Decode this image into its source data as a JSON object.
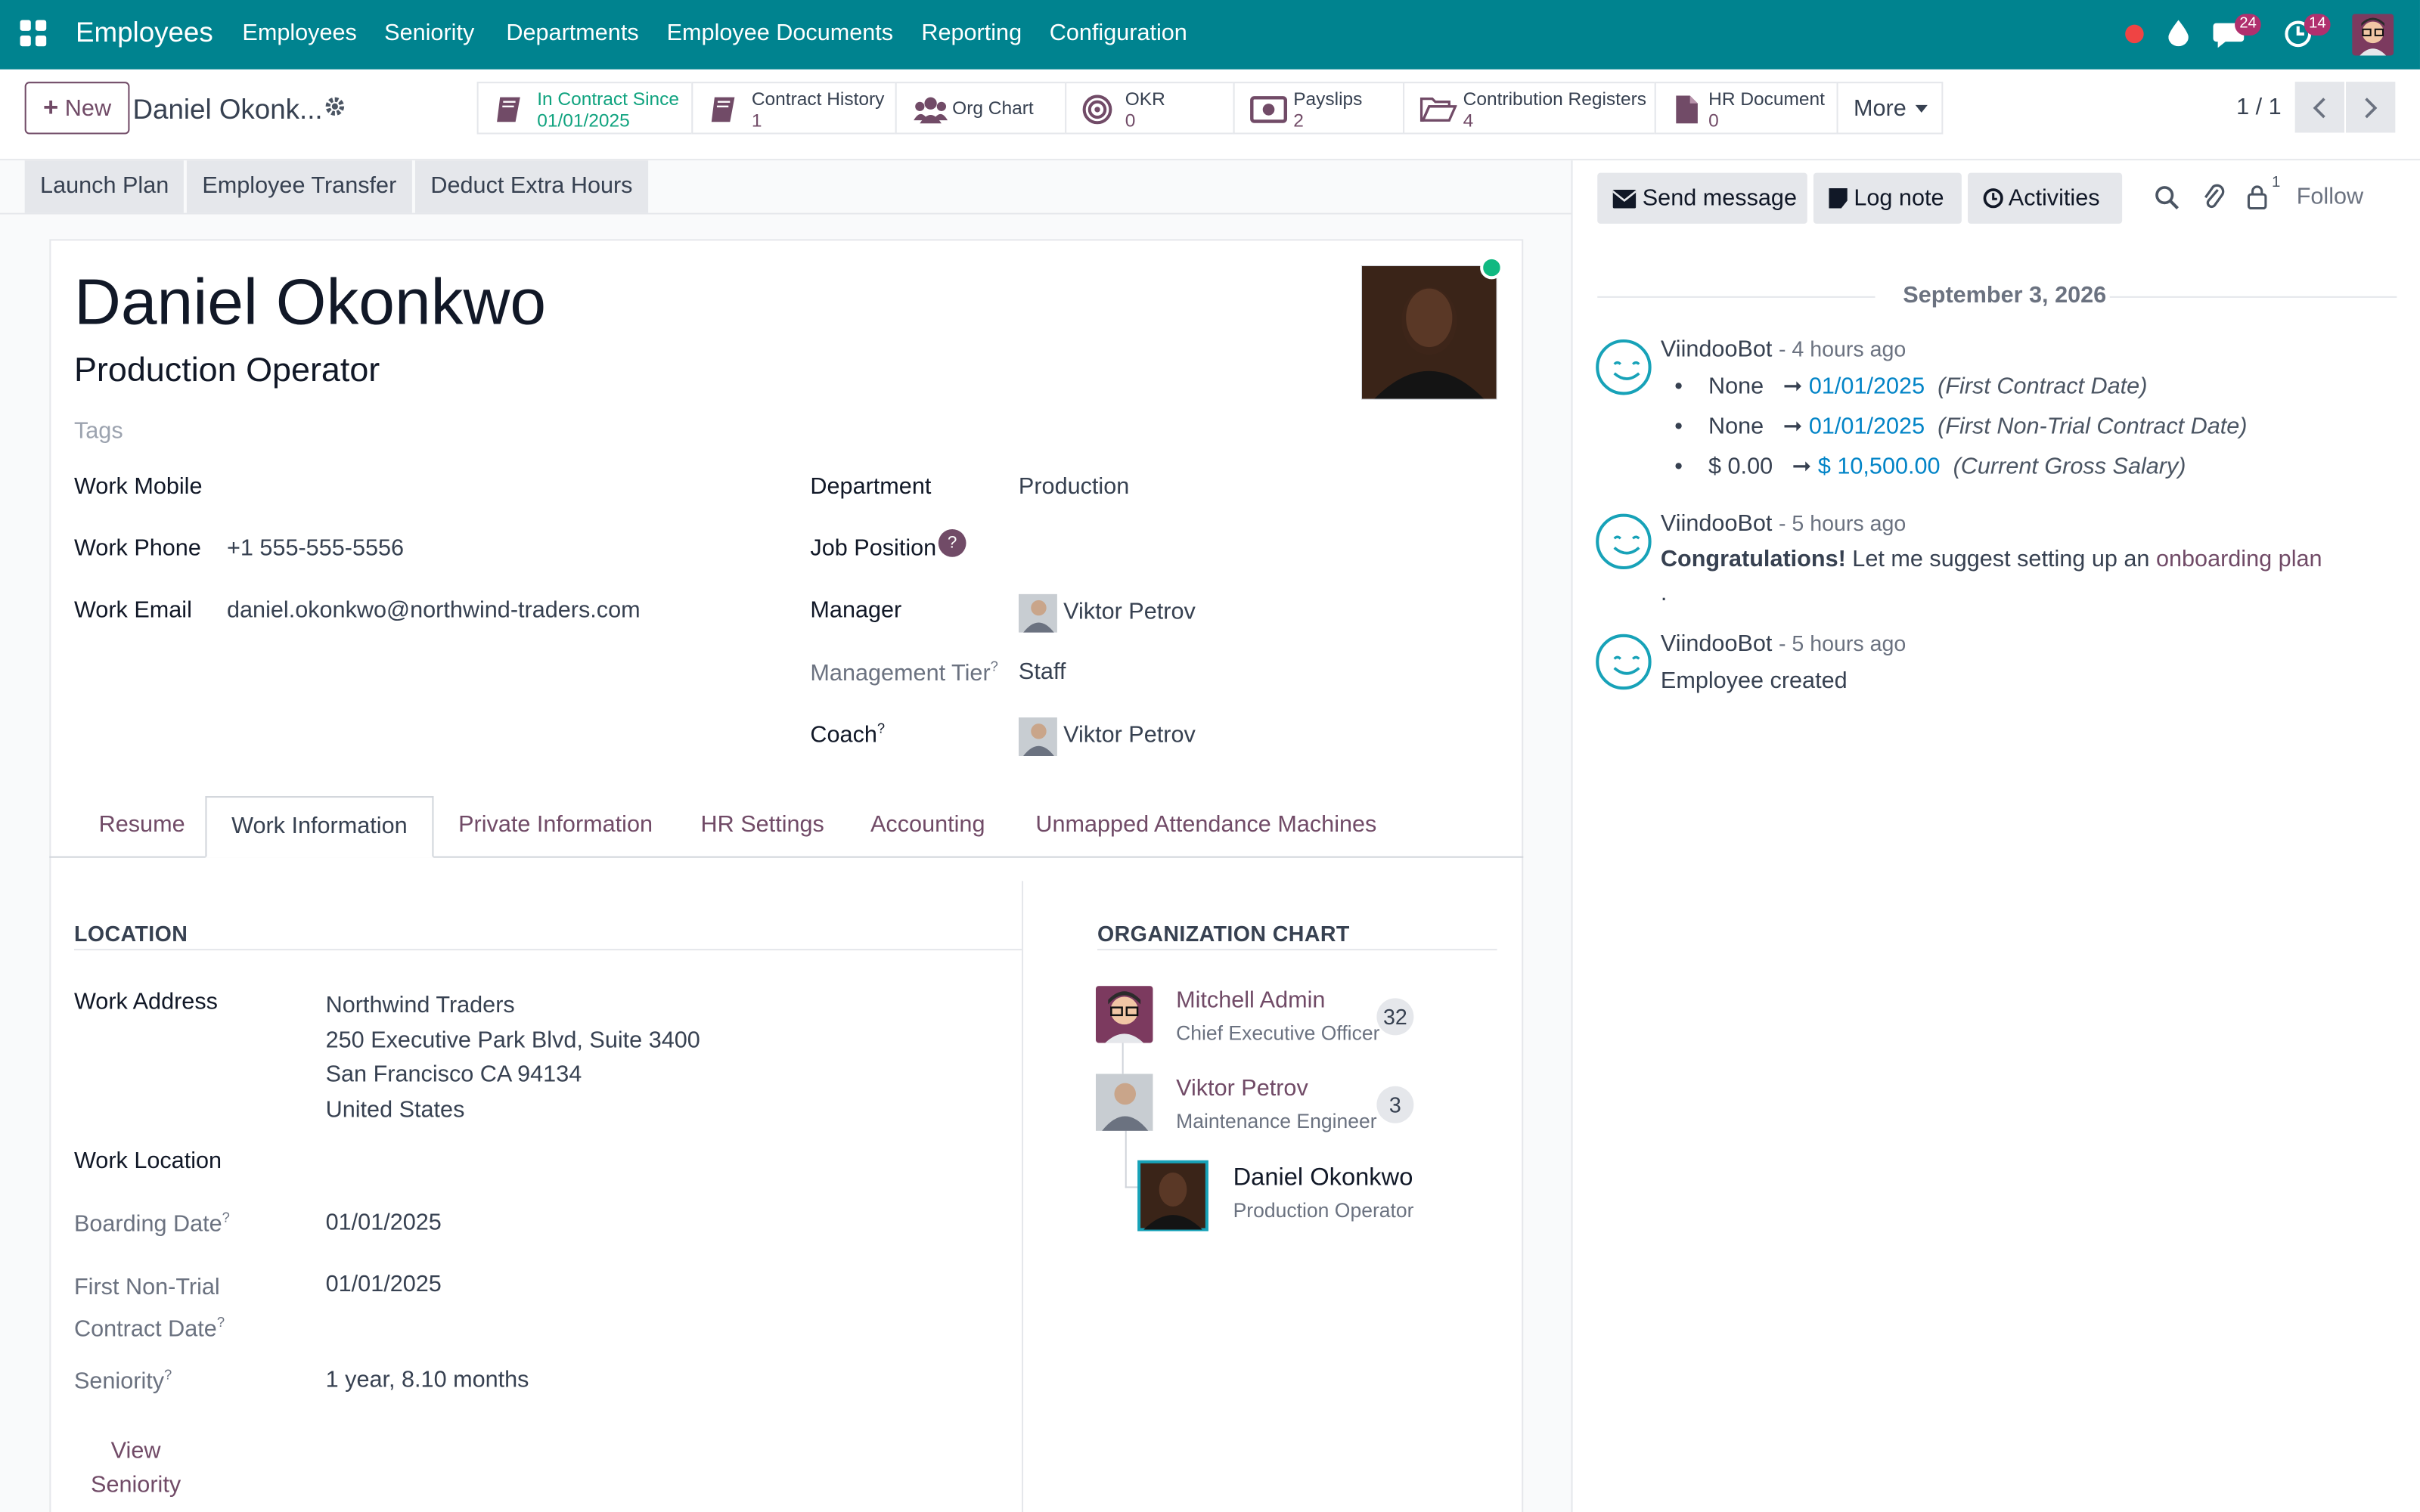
{
  "nav": {
    "app": "Employees",
    "menus": [
      "Employees",
      "Seniority",
      "Departments",
      "Employee Documents",
      "Reporting",
      "Configuration"
    ],
    "chat_count": "24",
    "activity_count": "14"
  },
  "control": {
    "new_label": "New",
    "record_name": "Daniel Okonk...",
    "pager": "1 / 1"
  },
  "smart_buttons": [
    {
      "label": "In Contract Since",
      "value": "01/01/2025"
    },
    {
      "label": "Contract History",
      "value": "1"
    },
    {
      "label": "Org Chart",
      "value": ""
    },
    {
      "label": "OKR",
      "value": "0"
    },
    {
      "label": "Payslips",
      "value": "2"
    },
    {
      "label": "Contribution Registers",
      "value": "4"
    },
    {
      "label": "HR Document",
      "value": "0"
    },
    {
      "label": "More",
      "value": ""
    }
  ],
  "actions": [
    "Launch Plan",
    "Employee Transfer",
    "Deduct Extra Hours"
  ],
  "employee": {
    "name": "Daniel Okonkwo",
    "job_title": "Production Operator",
    "tags_placeholder": "Tags"
  },
  "fields_left": [
    {
      "label": "Work Mobile",
      "value": ""
    },
    {
      "label": "Work Phone",
      "value": "+1 555-555-5556"
    },
    {
      "label": "Work Email",
      "value": "daniel.okonkwo@northwind-traders.com"
    }
  ],
  "fields_right": {
    "department": {
      "label": "Department",
      "value": "Production"
    },
    "job_position": {
      "label": "Job Position",
      "help": "?"
    },
    "manager": {
      "label": "Manager",
      "value": "Viktor Petrov"
    },
    "management_tier": {
      "label": "Management Tier",
      "help": "?",
      "value": "Staff"
    },
    "coach": {
      "label": "Coach",
      "help": "?",
      "value": "Viktor Petrov"
    }
  },
  "tabs": [
    "Resume",
    "Work Information",
    "Private Information",
    "HR Settings",
    "Accounting",
    "Unmapped Attendance Machines"
  ],
  "location": {
    "title": "LOCATION",
    "work_address_label": "Work Address",
    "address": [
      "Northwind Traders",
      "250 Executive Park Blvd, Suite 3400",
      "San Francisco CA 94134",
      "United States"
    ],
    "work_location_label": "Work Location",
    "boarding_label": "Boarding Date",
    "boarding_value": "01/01/2025",
    "first_nontrial_label_1": "First Non-Trial",
    "first_nontrial_label_2": "Contract Date",
    "first_nontrial_value": "01/01/2025",
    "seniority_label": "Seniority",
    "seniority_value": "1 year, 8.10 months",
    "view_seniority_1": "View",
    "view_seniority_2": "Seniority",
    "help": "?"
  },
  "org_chart": {
    "title": "ORGANIZATION CHART",
    "people": [
      {
        "name": "Mitchell Admin",
        "role": "Chief Executive Officer",
        "count": "32"
      },
      {
        "name": "Viktor Petrov",
        "role": "Maintenance Engineer",
        "count": "3"
      },
      {
        "name": "Daniel Okonkwo",
        "role": "Production Operator"
      }
    ]
  },
  "chatter": {
    "send_message": "Send message",
    "log_note": "Log note",
    "activities": "Activities",
    "follow": "Follow",
    "followers": "1",
    "date": "September 3, 2026",
    "messages": [
      {
        "author": "ViindooBot",
        "time": "- 4 hours ago",
        "changes": [
          {
            "old": "None",
            "new": "01/01/2025",
            "field": "(First Contract Date)"
          },
          {
            "old": "None",
            "new": "01/01/2025",
            "field": "(First Non-Trial Contract Date)"
          },
          {
            "old": "$ 0.00",
            "new": "$ 10,500.00",
            "field": "(Current Gross Salary)"
          }
        ]
      },
      {
        "author": "ViindooBot",
        "time": "- 5 hours ago",
        "bold": "Congratulations!",
        "text": "Let me suggest setting up an",
        "link": "onboarding plan",
        "tail": "."
      },
      {
        "author": "ViindooBot",
        "time": "- 5 hours ago",
        "text": "Employee created"
      }
    ]
  },
  "colors": {
    "brand": "#00838f",
    "accent": "#714b67",
    "online": "#10b981",
    "link_blue": "#0284c7"
  }
}
